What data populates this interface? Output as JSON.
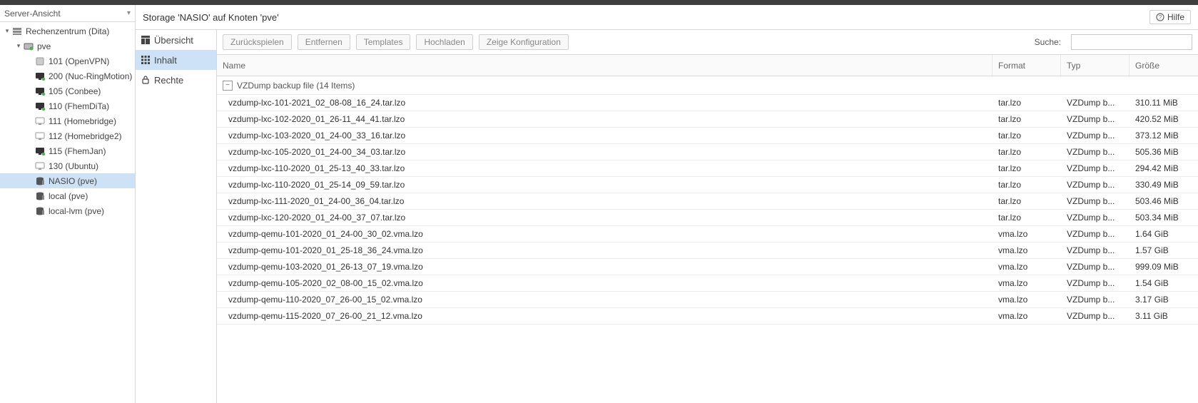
{
  "view_selector": "Server-Ansicht",
  "tree": [
    {
      "indent": 0,
      "expand": "open",
      "icon": "datacenter",
      "label": "Rechenzentrum (Dita)"
    },
    {
      "indent": 1,
      "expand": "open",
      "icon": "node",
      "label": "pve"
    },
    {
      "indent": 2,
      "expand": "none",
      "icon": "lxc-off",
      "label": "101 (OpenVPN)"
    },
    {
      "indent": 2,
      "expand": "none",
      "icon": "qemu-on",
      "label": "200 (Nuc-RingMotion)"
    },
    {
      "indent": 2,
      "expand": "none",
      "icon": "qemu-on-net",
      "label": "105 (Conbee)"
    },
    {
      "indent": 2,
      "expand": "none",
      "icon": "qemu-on-net",
      "label": "110 (FhemDiTa)"
    },
    {
      "indent": 2,
      "expand": "none",
      "icon": "qemu-off",
      "label": "111 (Homebridge)"
    },
    {
      "indent": 2,
      "expand": "none",
      "icon": "qemu-off",
      "label": "112 (Homebridge2)"
    },
    {
      "indent": 2,
      "expand": "none",
      "icon": "qemu-on-net",
      "label": "115 (FhemJan)"
    },
    {
      "indent": 2,
      "expand": "none",
      "icon": "qemu-off",
      "label": "130 (Ubuntu)"
    },
    {
      "indent": 2,
      "expand": "none",
      "icon": "storage",
      "label": "NASIO (pve)",
      "selected": true
    },
    {
      "indent": 2,
      "expand": "none",
      "icon": "storage",
      "label": "local (pve)"
    },
    {
      "indent": 2,
      "expand": "none",
      "icon": "storage",
      "label": "local-lvm (pve)"
    }
  ],
  "content_title": "Storage 'NASIO' auf Knoten 'pve'",
  "help_label": "Hilfe",
  "innernav": [
    {
      "icon": "dashboard",
      "label": "Übersicht",
      "selected": false
    },
    {
      "icon": "grid",
      "label": "Inhalt",
      "selected": true
    },
    {
      "icon": "lock",
      "label": "Rechte",
      "selected": false
    }
  ],
  "toolbar": {
    "restore": "Zurückspielen",
    "remove": "Entfernen",
    "templates": "Templates",
    "upload": "Hochladen",
    "showconfig": "Zeige Konfiguration",
    "search_label": "Suche:",
    "search_value": ""
  },
  "columns": {
    "name": "Name",
    "format": "Format",
    "type": "Typ",
    "size": "Größe"
  },
  "group_label": "VZDump backup file (14 Items)",
  "rows": [
    {
      "name": "vzdump-lxc-101-2021_02_08-08_16_24.tar.lzo",
      "format": "tar.lzo",
      "type": "VZDump b...",
      "size": "310.11 MiB"
    },
    {
      "name": "vzdump-lxc-102-2020_01_26-11_44_41.tar.lzo",
      "format": "tar.lzo",
      "type": "VZDump b...",
      "size": "420.52 MiB"
    },
    {
      "name": "vzdump-lxc-103-2020_01_24-00_33_16.tar.lzo",
      "format": "tar.lzo",
      "type": "VZDump b...",
      "size": "373.12 MiB"
    },
    {
      "name": "vzdump-lxc-105-2020_01_24-00_34_03.tar.lzo",
      "format": "tar.lzo",
      "type": "VZDump b...",
      "size": "505.36 MiB"
    },
    {
      "name": "vzdump-lxc-110-2020_01_25-13_40_33.tar.lzo",
      "format": "tar.lzo",
      "type": "VZDump b...",
      "size": "294.42 MiB"
    },
    {
      "name": "vzdump-lxc-110-2020_01_25-14_09_59.tar.lzo",
      "format": "tar.lzo",
      "type": "VZDump b...",
      "size": "330.49 MiB"
    },
    {
      "name": "vzdump-lxc-111-2020_01_24-00_36_04.tar.lzo",
      "format": "tar.lzo",
      "type": "VZDump b...",
      "size": "503.46 MiB"
    },
    {
      "name": "vzdump-lxc-120-2020_01_24-00_37_07.tar.lzo",
      "format": "tar.lzo",
      "type": "VZDump b...",
      "size": "503.34 MiB"
    },
    {
      "name": "vzdump-qemu-101-2020_01_24-00_30_02.vma.lzo",
      "format": "vma.lzo",
      "type": "VZDump b...",
      "size": "1.64 GiB"
    },
    {
      "name": "vzdump-qemu-101-2020_01_25-18_36_24.vma.lzo",
      "format": "vma.lzo",
      "type": "VZDump b...",
      "size": "1.57 GiB"
    },
    {
      "name": "vzdump-qemu-103-2020_01_26-13_07_19.vma.lzo",
      "format": "vma.lzo",
      "type": "VZDump b...",
      "size": "999.09 MiB"
    },
    {
      "name": "vzdump-qemu-105-2020_02_08-00_15_02.vma.lzo",
      "format": "vma.lzo",
      "type": "VZDump b...",
      "size": "1.54 GiB"
    },
    {
      "name": "vzdump-qemu-110-2020_07_26-00_15_02.vma.lzo",
      "format": "vma.lzo",
      "type": "VZDump b...",
      "size": "3.17 GiB"
    },
    {
      "name": "vzdump-qemu-115-2020_07_26-00_21_12.vma.lzo",
      "format": "vma.lzo",
      "type": "VZDump b...",
      "size": "3.11 GiB"
    }
  ]
}
